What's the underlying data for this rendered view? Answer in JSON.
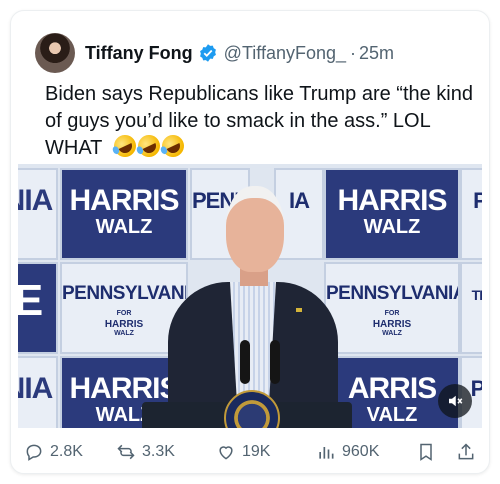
{
  "tweet": {
    "author_name": "Tiffany Fong",
    "handle": "@TiffanyFong_",
    "separator": "·",
    "time": "25m",
    "text": "Biden says Republicans like Trump are “the kind of guys you’d like to smack in the ass.” LOL WHAT",
    "emoji": [
      "rolling-on-floor-laughing",
      "rolling-on-floor-laughing",
      "rolling-on-floor-laughing"
    ],
    "verified": true
  },
  "media": {
    "signs": {
      "harris": "HARRIS",
      "walz": "WALZ",
      "pennsylvania": "PENNSYLVANIA",
      "for": "FOR",
      "harris_small": "HARRIS",
      "walz_small": "WALZ",
      "nia_left": "NIA",
      "penn_partial": "PENN",
      "ia_partial": "IA",
      "p_right": "P",
      "pi_right": "PI",
      "th_right": "TH",
      "e_left": "E",
      "harris_partial": "HARRIS",
      "walz_partial": "WALZ",
      "arris_partial": "ARRIS",
      "valz_partial": "VALZ"
    },
    "mute_icon": "volume-muted-icon"
  },
  "actions": {
    "replies": "2.8K",
    "reposts": "3.3K",
    "likes": "19K",
    "views": "960K"
  },
  "colors": {
    "text_primary": "#0f1419",
    "text_secondary": "#536471",
    "verified_blue": "#1d9bf0",
    "sign_navy": "#2b3a7c"
  }
}
